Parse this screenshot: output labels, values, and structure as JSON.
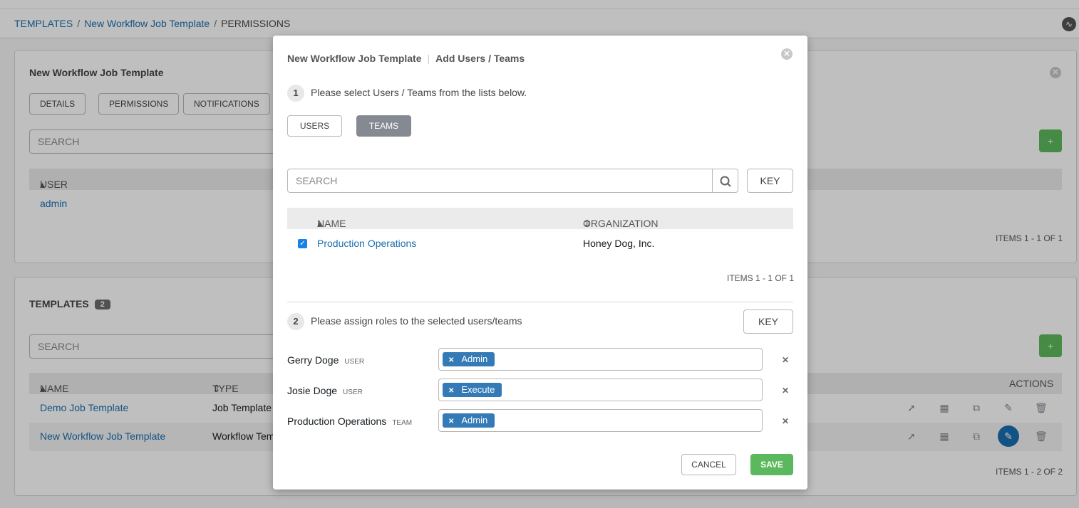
{
  "breadcrumb": {
    "items": [
      "TEMPLATES",
      "New Workflow Job Template",
      "PERMISSIONS"
    ],
    "separator": "/"
  },
  "permissions_panel": {
    "title": "New Workflow Job Template",
    "tabs": [
      "DETAILS",
      "PERMISSIONS",
      "NOTIFICATIONS"
    ],
    "search_placeholder": "SEARCH",
    "add_label": "+",
    "column_user": "USER",
    "rows": [
      "admin"
    ],
    "items_count": "ITEMS  1 - 1 OF 1"
  },
  "templates_panel": {
    "title": "TEMPLATES",
    "count": "2",
    "search_placeholder": "SEARCH",
    "add_label": "+",
    "columns": {
      "name": "NAME",
      "type": "TYPE",
      "actions": "ACTIONS"
    },
    "rows": [
      {
        "name": "Demo Job Template",
        "type": "Job Template"
      },
      {
        "name": "New Workflow Job Template",
        "type": "Workflow Template"
      }
    ],
    "items_count": "ITEMS  1 - 2 OF 2"
  },
  "modal": {
    "title": "New Workflow Job Template",
    "subtitle": "Add Users / Teams",
    "step1": {
      "num": "1",
      "text": "Please select Users / Teams from the lists below."
    },
    "toggles": {
      "users": "USERS",
      "teams": "TEAMS",
      "active": "teams"
    },
    "search_placeholder": "SEARCH",
    "key_label": "KEY",
    "columns": {
      "name": "NAME",
      "organization": "ORGANIZATION"
    },
    "rows": [
      {
        "name": "Production Operations",
        "organization": "Honey Dog, Inc.",
        "checked": true
      }
    ],
    "items_count": "ITEMS  1 - 1 OF 1",
    "step2": {
      "num": "2",
      "text": "Please assign roles to the selected users/teams"
    },
    "key2_label": "KEY",
    "assignments": [
      {
        "name": "Gerry Doge",
        "type": "USER",
        "role": "Admin"
      },
      {
        "name": "Josie Doge",
        "type": "USER",
        "role": "Execute"
      },
      {
        "name": "Production Operations",
        "type": "TEAM",
        "role": "Admin"
      }
    ],
    "cancel_label": "CANCEL",
    "save_label": "SAVE"
  },
  "colors": {
    "link": "#1a6fb0",
    "success": "#5cb85c",
    "role_tag": "#337ab7",
    "toggle_active": "#848992"
  }
}
